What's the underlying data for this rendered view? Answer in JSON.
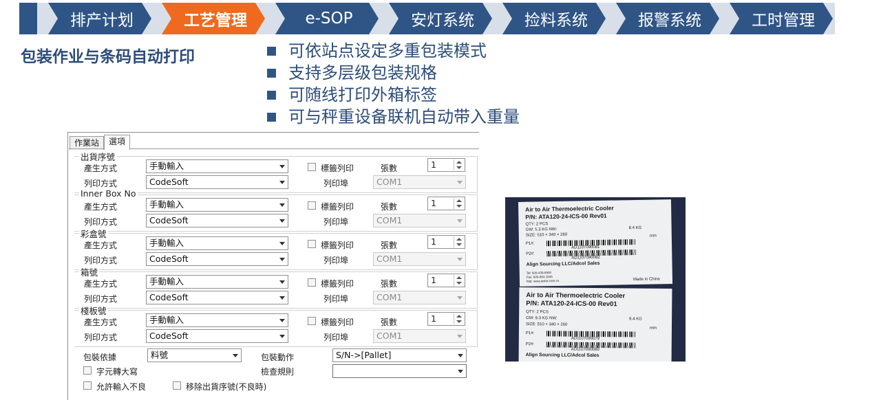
{
  "nav": {
    "items": [
      {
        "label": "排产计划",
        "active": false
      },
      {
        "label": "工艺管理",
        "active": true
      },
      {
        "label": "e-SOP",
        "active": false
      },
      {
        "label": "安灯系统",
        "active": false
      },
      {
        "label": "捡料系统",
        "active": false
      },
      {
        "label": "报警系统",
        "active": false
      },
      {
        "label": "工时管理",
        "active": false
      }
    ]
  },
  "heading": "包装作业与条码自动打印",
  "bullets": [
    "可依站点设定多重包装模式",
    "支持多层级包装规格",
    "可随线打印外箱标签",
    "可与秤重设备联机自动带入重量"
  ],
  "colors": {
    "nav": "#2f5586",
    "active": "#ef6a1e",
    "text": "#2c4d79"
  },
  "dialog": {
    "tabs": [
      {
        "label": "作業站",
        "selected": false
      },
      {
        "label": "選項",
        "selected": true
      }
    ],
    "common": {
      "mode_label": "產生方式",
      "print_mode_label": "列印方式",
      "label_print_label": "標籤列印",
      "count_label": "張數",
      "printer_label": "列印埠"
    },
    "groups": [
      {
        "title": "出貨序號",
        "mode": "手動輸入",
        "print_mode": "CodeSoft",
        "count": "1",
        "printer": "COM1"
      },
      {
        "title": "Inner Box No",
        "mode": "手動輸入",
        "print_mode": "CodeSoft",
        "count": "1",
        "printer": "COM1"
      },
      {
        "title": "彩盒號",
        "mode": "手動輸入",
        "print_mode": "CodeSoft",
        "count": "1",
        "printer": "COM1"
      },
      {
        "title": "箱號",
        "mode": "手動輸入",
        "print_mode": "CodeSoft",
        "count": "1",
        "printer": "COM1"
      },
      {
        "title": "棧板號",
        "mode": "手動輸入",
        "print_mode": "CodeSoft",
        "count": "1",
        "printer": "COM1"
      }
    ],
    "bottom": {
      "basis_label": "包裝依據",
      "basis_value": "料號",
      "action_label": "包裝動作",
      "action_value": "S/N->[Pallet]",
      "rule_label": "檢查規則",
      "rule_value": "",
      "uppercase_label": "字元轉大寫",
      "allow_bad_label": "允許輸入不良",
      "remove_label": "移除出貨序號(不良時)"
    }
  },
  "photo": {
    "labels": [
      {
        "title": "Air to Air Thermoelectric Cooler",
        "pn": "P/N:  ATA120-24-ICS-00 Rev01",
        "qty": "QTY:   2    PCS",
        "gw": "GW:       5.3   KG     NW:",
        "nw": "8.4 KG",
        "size": "SIZE:  510 × 340 × 260",
        "unit": "mm",
        "p1": "P1#:",
        "p1_code": "AD1107090081",
        "p2": "P2#:",
        "p2_code": "AD1107090082",
        "company": "Align Sourcing LLC/Adcol Sales",
        "tel": "Tel: 609-439-8900",
        "fax": "Fax: 609-864-1545",
        "web": "http: www.adcol.com.cn",
        "origin": "Made in China"
      },
      {
        "title": "Air to Air Thermoelectric Cooler",
        "pn": "P/N:  ATA120-24-ICS-00 Rev01",
        "qty": "QTY:   2    PCS",
        "gw": "GW:       9.3   KG     NW:",
        "nw": "8.4 KG",
        "size": "SIZE:  510 × 340 × 260",
        "unit": "mm",
        "p1": "P1#:",
        "p1_code": "AD1107090079",
        "p2": "P2#:",
        "p2_code": "AD1107090080",
        "company": "Align Sourcing LLC/Adcol Sales"
      }
    ]
  }
}
